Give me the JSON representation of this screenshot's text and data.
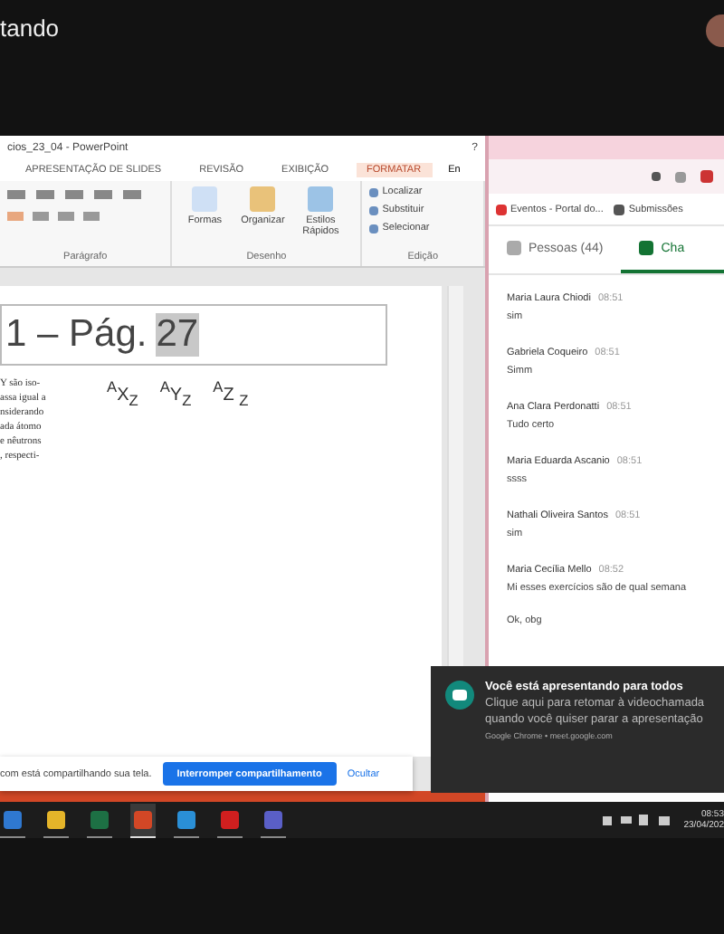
{
  "meeting": {
    "title": "tando"
  },
  "powerpoint": {
    "title": "cios_23_04 - PowerPoint",
    "help": "?",
    "tabs": [
      {
        "label": "APRESENTAÇÃO DE SLIDES",
        "selected": false
      },
      {
        "label": "REVISÃO",
        "selected": false
      },
      {
        "label": "EXIBIÇÃO",
        "selected": false
      },
      {
        "label": "FORMATAR",
        "selected": true
      }
    ],
    "account": "En",
    "groups": [
      {
        "kind": "paragraph",
        "label": "Parágrafo"
      },
      {
        "kind": "drawing",
        "label": "Desenho",
        "buttons": [
          "Formas",
          "Organizar",
          "Estilos Rápidos"
        ]
      },
      {
        "kind": "editing",
        "label": "Edição",
        "buttons": [
          "Localizar",
          "Substituir",
          "Selecionar"
        ]
      }
    ],
    "slide": {
      "title": "1 – Pág.",
      "title_selection": "27",
      "body": [
        "Y são iso-",
        "assa igual a",
        "nsiderando",
        "ada átomo",
        "e nêutrons",
        ", respecti-"
      ],
      "isotopes": [
        "$^{A}$X$_{Z}$",
        "$^{A}$Y$_{Z}$",
        "$^{A}$Z $_{Z}$"
      ]
    }
  },
  "chrome": {
    "bookmarks": [
      "Eventos - Portal do...",
      "Submissões"
    ],
    "tabs": [
      {
        "label": "Pessoas (44)",
        "selected": false
      },
      {
        "label": "Cha",
        "selected": true
      }
    ],
    "messages": [
      {
        "name": "Maria Laura Chiodi",
        "time": "08:51",
        "lines": [
          "sim"
        ]
      },
      {
        "name": "Gabriela Coqueiro",
        "time": "08:51",
        "lines": [
          "Simm"
        ]
      },
      {
        "name": "Ana Clara Perdonatti",
        "time": "08:51",
        "lines": [
          "Tudo certo"
        ]
      },
      {
        "name": "Maria Eduarda Ascanio",
        "time": "08:51",
        "lines": [
          "ssss"
        ]
      },
      {
        "name": "Nathali Oliveira Santos",
        "time": "08:51",
        "lines": [
          "sim"
        ]
      },
      {
        "name": "Maria Cecília Mello",
        "time": "08:52",
        "lines": [
          "Mi esses exercícios são de qual semana",
          "Ok, obg"
        ]
      }
    ]
  },
  "share_bar": {
    "message": "com está compartilhando sua tela.",
    "stop_button": "Interromper compartilhamento",
    "hide_link": "Ocultar"
  },
  "notification": {
    "title": "Você está apresentando para todos",
    "body": "Clique aqui para retomar à videochamada quando você quiser parar a apresentação",
    "source": "Google Chrome • meet.google.com"
  },
  "taskbar": {
    "apps": [
      {
        "kind": "files",
        "selected": false
      },
      {
        "kind": "chrome",
        "selected": false
      },
      {
        "kind": "excel",
        "selected": false
      },
      {
        "kind": "powerpoint",
        "selected": true
      },
      {
        "kind": "edge",
        "selected": false
      },
      {
        "kind": "pdf",
        "selected": false
      },
      {
        "kind": "teams",
        "selected": false
      }
    ],
    "time": "08:53",
    "date": "23/04/202"
  }
}
